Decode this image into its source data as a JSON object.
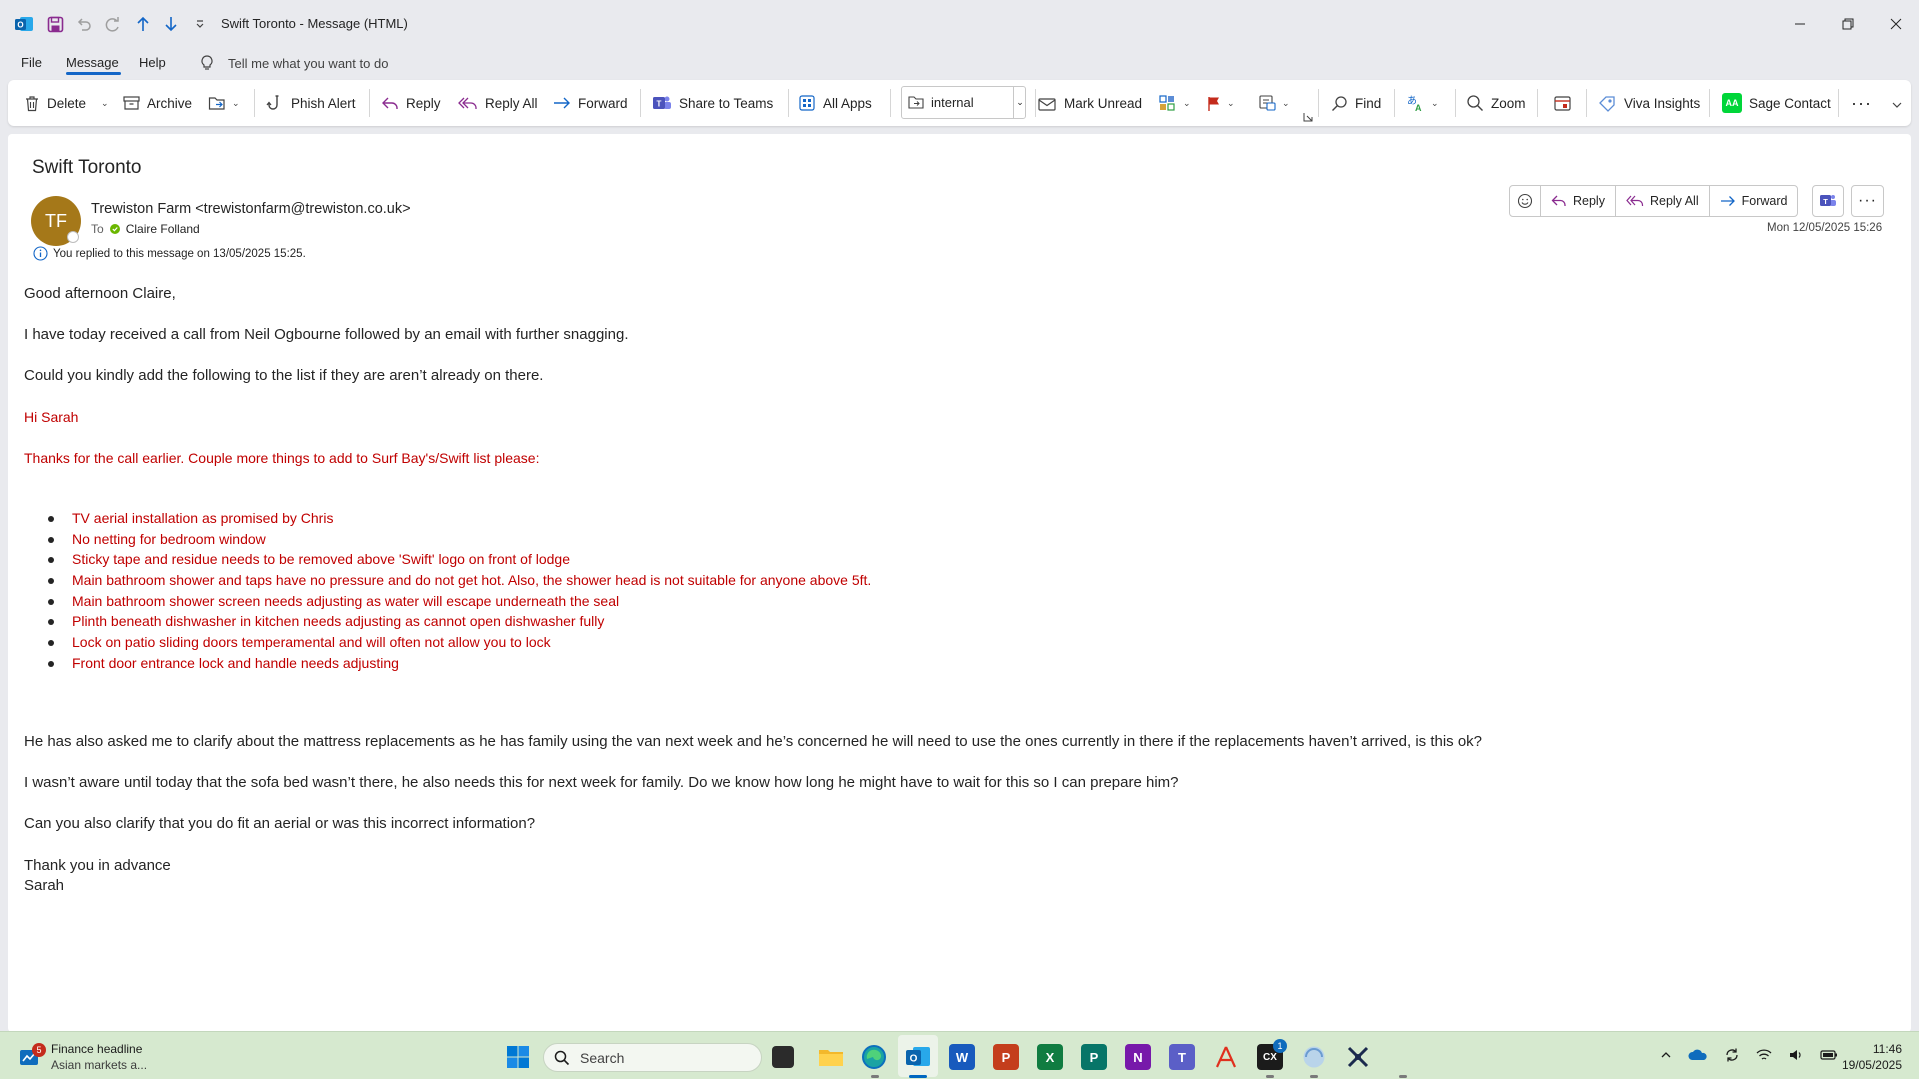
{
  "window": {
    "title": "Swift Toronto  -  Message (HTML)"
  },
  "menu": {
    "tabs": [
      "File",
      "Message",
      "Help"
    ],
    "tell_me": "Tell me what you want to do"
  },
  "ribbon": {
    "delete": "Delete",
    "archive": "Archive",
    "phish_alert": "Phish Alert",
    "reply": "Reply",
    "reply_all": "Reply All",
    "forward": "Forward",
    "share_to_teams": "Share to Teams",
    "all_apps": "All Apps",
    "category_value": "internal",
    "mark_unread": "Mark Unread",
    "find": "Find",
    "zoom": "Zoom",
    "viva_insights": "Viva Insights",
    "sage_contact": "Sage Contact",
    "sage_contact_logo_text": "AA"
  },
  "message": {
    "subject": "Swift Toronto",
    "sender_initials": "TF",
    "sender": "Trewiston Farm <trewistonfarm@trewiston.co.uk>",
    "to_label": "To",
    "recipient": "Claire Folland",
    "info": "You replied to this message on 13/05/2025 15:25.",
    "timestamp": "Mon 12/05/2025 15:26",
    "actions": {
      "reply": "Reply",
      "reply_all": "Reply All",
      "forward": "Forward"
    },
    "body": {
      "greeting": "Good afternoon Claire,",
      "p1": "I have today received a call from Neil Ogbourne followed by an email with further snagging.",
      "p2": "Could you kindly add the following to the list if they are aren’t already on there.",
      "quoted_greeting": "Hi Sarah",
      "quoted_intro": "Thanks for the call earlier. Couple more things to add to Surf Bay's/Swift list please:",
      "snag_items": [
        "TV aerial installation as promised by Chris",
        "No netting for bedroom window",
        "Sticky tape and residue needs to be removed above 'Swift' logo on front of lodge",
        "Main bathroom shower and taps have no pressure and do not get hot. Also, the shower head is not suitable for anyone above 5ft.",
        "Main bathroom shower screen needs adjusting as water will escape underneath the seal",
        "Plinth beneath dishwasher in kitchen needs adjusting as cannot open dishwasher fully",
        "Lock on patio sliding doors temperamental and will often not allow you to lock",
        "Front door entrance lock and handle needs adjusting"
      ],
      "p3": "He has also asked me to clarify about the mattress replacements as he has family using the van next week and he’s concerned he will need to use the ones currently in there if the replacements haven’t arrived, is this ok?",
      "p4": "I wasn’t aware until today that the sofa bed wasn’t there, he also needs this for next week for family. Do we know how long he might have to wait for this so I can prepare him?",
      "p5": "Can you also clarify that you do fit an aerial or was this incorrect information?",
      "signoff": "Thank you in advance",
      "signature": "Sarah"
    }
  },
  "taskbar": {
    "widget_title": "Finance headline",
    "widget_subtitle": "Asian markets a...",
    "widget_badge": "5",
    "search_label": "Search",
    "app_badge": "1",
    "time": "11:46",
    "date": "19/05/2025"
  },
  "colors": {
    "accent": "#1366c7",
    "quoted_text": "#c00000",
    "avatar": "#a57819",
    "presence": "#6bb700",
    "taskbar": "#d6e9cf"
  }
}
